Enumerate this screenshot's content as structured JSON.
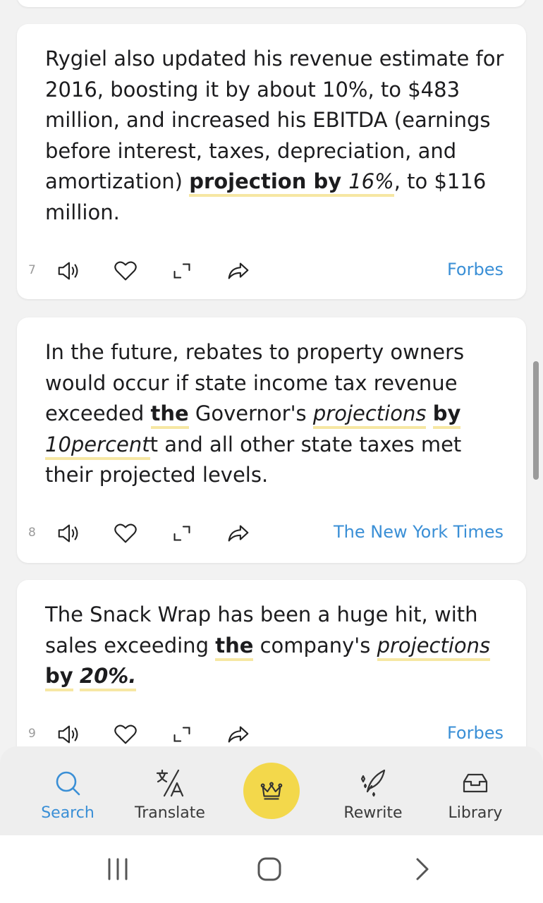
{
  "cards": [
    {
      "index": "7",
      "sentence": {
        "pre": "Rygiel also updated his revenue estimate for 2016, boosting it by about 10%, to $483 million, and increased his EBITDA (earnings before interest, taxes, depreciation, and amortization) ",
        "hl1": "projection by",
        "hl2": "16%",
        "post": ", to $116 million."
      },
      "source": "Forbes"
    },
    {
      "index": "8",
      "sentence": {
        "pre": "In the future, rebates to property owners would occur if state income tax revenue exceeded ",
        "hl1": "the",
        "mid1": " Governor's ",
        "hl2": "projections",
        "mid2": " ",
        "hl3": "by",
        "mid3": " ",
        "hl4": "10percent",
        "post": "t and all other state taxes met their projected levels."
      },
      "source": "The New York Times"
    },
    {
      "index": "9",
      "sentence": {
        "pre": "The Snack Wrap has been a huge hit, with sales exceeding ",
        "hl1": "the",
        "mid1": " company's ",
        "hl2": "projections",
        "mid2": " ",
        "hl3": "by",
        "mid3": " ",
        "hl4": "20%.",
        "post": ""
      },
      "source": "Forbes"
    }
  ],
  "tabs": {
    "search": "Search",
    "translate": "Translate",
    "rewrite": "Rewrite",
    "library": "Library"
  },
  "colors": {
    "accent": "#3a8fd6",
    "highlight": "#f6e7a3",
    "premium": "#f3d84b"
  },
  "icons": [
    "speaker-icon",
    "heart-icon",
    "expand-icon",
    "share-icon",
    "search-icon",
    "translate-icon",
    "crown-icon",
    "quill-icon",
    "inbox-icon"
  ]
}
